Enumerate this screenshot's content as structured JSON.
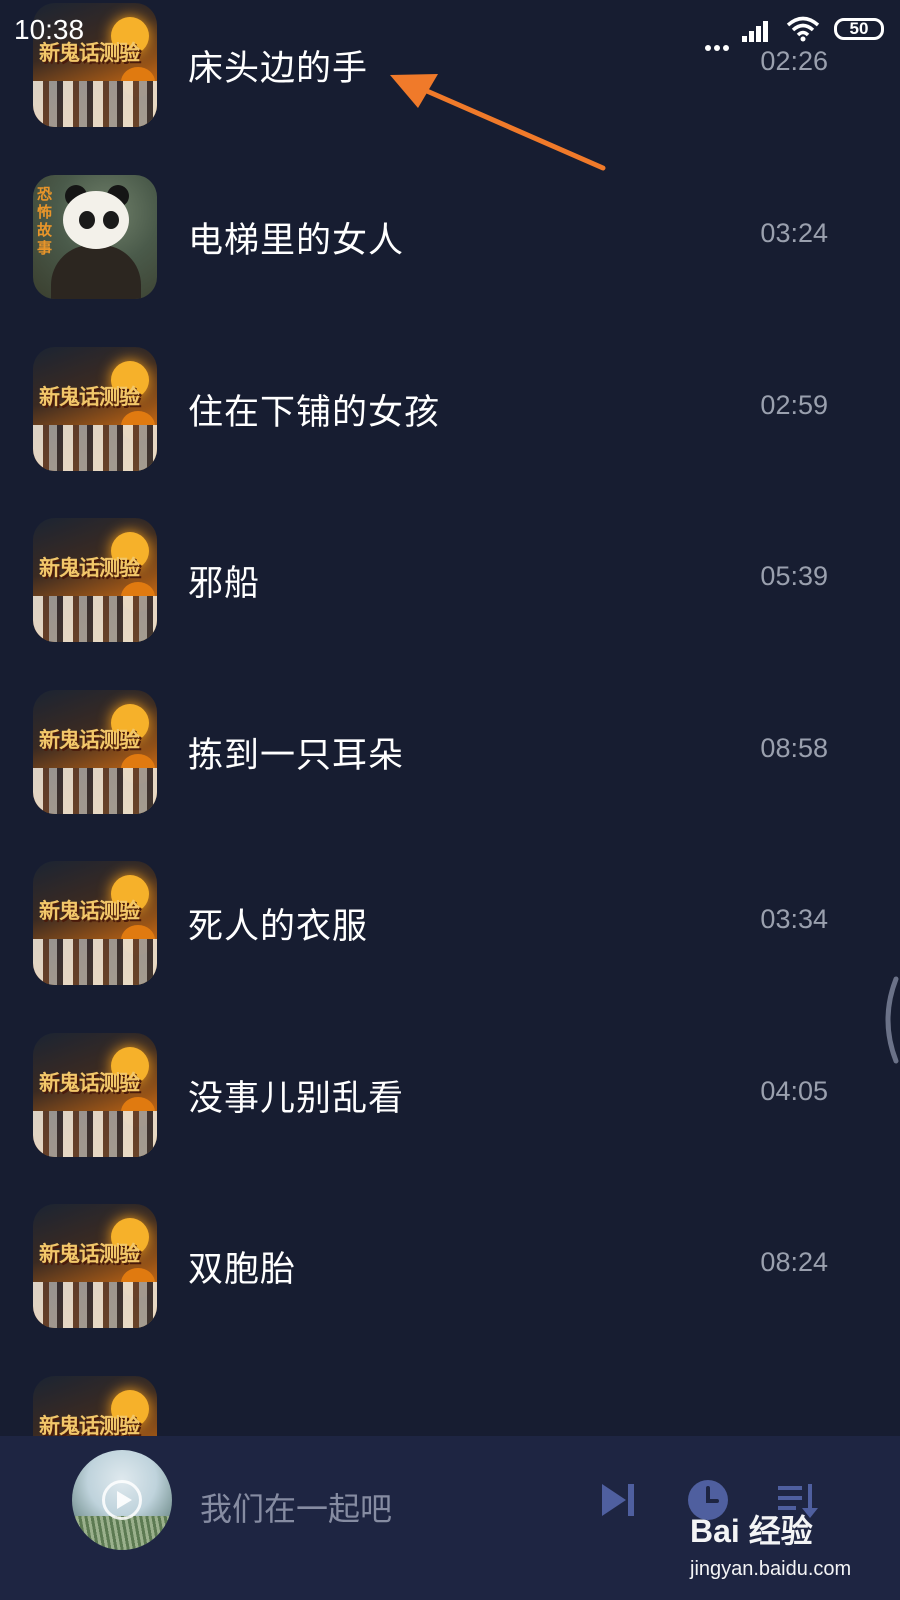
{
  "status_bar": {
    "time": "10:38",
    "battery": "50"
  },
  "tracks": [
    {
      "title": "床头边的手",
      "duration": "02:26",
      "cover": "halloween-cover"
    },
    {
      "title": "电梯里的女人",
      "duration": "03:24",
      "cover": "panda-cover"
    },
    {
      "title": "住在下铺的女孩",
      "duration": "02:59",
      "cover": "halloween-cover"
    },
    {
      "title": "邪船",
      "duration": "05:39",
      "cover": "halloween-cover"
    },
    {
      "title": "拣到一只耳朵",
      "duration": "08:58",
      "cover": "halloween-cover"
    },
    {
      "title": "死人的衣服",
      "duration": "03:34",
      "cover": "halloween-cover"
    },
    {
      "title": "没事儿别乱看",
      "duration": "04:05",
      "cover": "halloween-cover"
    },
    {
      "title": "双胞胎",
      "duration": "08:24",
      "cover": "halloween-cover"
    },
    {
      "title": "",
      "duration": "",
      "cover": "halloween-cover"
    }
  ],
  "covers": {
    "halloween_text": "新鬼话测验",
    "panda_side_text": "恐怖故事"
  },
  "player": {
    "now_playing": "我们在一起吧",
    "icons": [
      "skip-next-icon",
      "timer-icon",
      "playlist-icon"
    ]
  },
  "watermark": {
    "brand": "Bai  经验",
    "url": "jingyan.baidu.com"
  },
  "colors": {
    "background": "#171d31",
    "player_background": "#1e2542",
    "accent_icons": "#4f5f9f",
    "annotation_arrow": "#f07a2a",
    "duration_text": "#9aa0ae"
  }
}
